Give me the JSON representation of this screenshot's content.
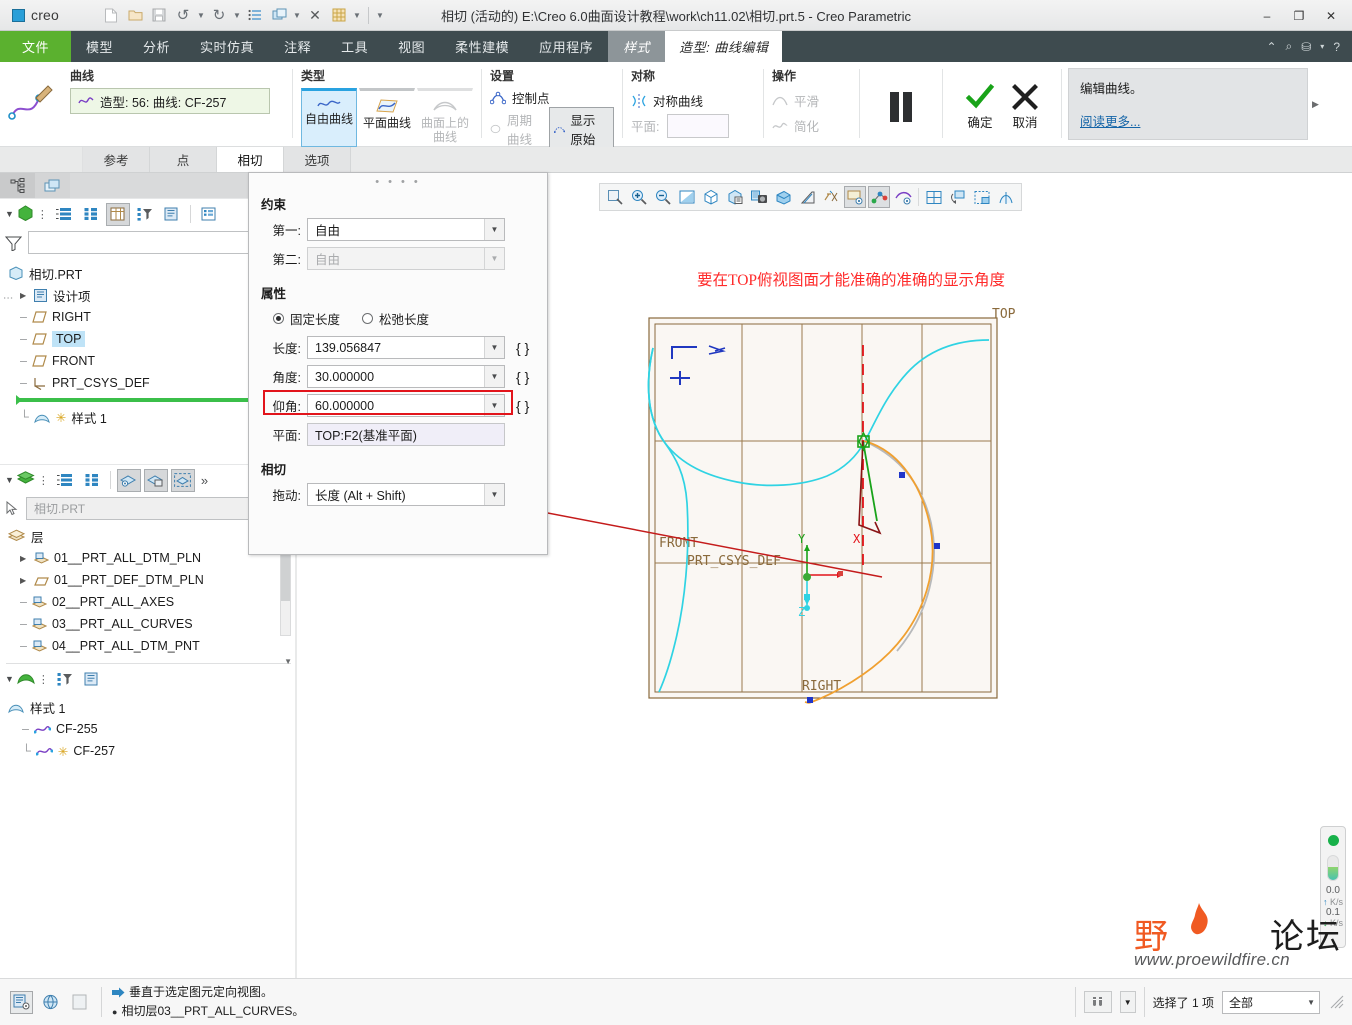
{
  "titlebar": {
    "brand": "creo",
    "title": "相切 (活动的) E:\\Creo 6.0曲面设计教程\\work\\ch11.02\\相切.prt.5 - Creo Parametric",
    "minimize": "–",
    "maximize": "❐",
    "close": "✕",
    "quick_access": [
      {
        "name": "new-file-icon",
        "glyph": "🗋"
      },
      {
        "name": "open-file-icon",
        "glyph": "🗁"
      },
      {
        "name": "save-icon",
        "glyph": "🖫"
      },
      {
        "name": "undo-icon",
        "glyph": "↰"
      },
      {
        "name": "redo-icon",
        "glyph": "↱"
      },
      {
        "name": "regenerate-icon",
        "glyph": "⣿"
      },
      {
        "name": "window-icon",
        "glyph": "❏"
      },
      {
        "name": "close-window-icon",
        "glyph": "⨯"
      },
      {
        "name": "grid-icon",
        "glyph": "▤"
      },
      {
        "name": "customize-icon",
        "glyph": "▾"
      }
    ]
  },
  "ribbon_tabs": {
    "file": "文件",
    "items": [
      "模型",
      "分析",
      "实时仿真",
      "注释",
      "工具",
      "视图",
      "柔性建模",
      "应用程序"
    ],
    "active_grey": "样式",
    "active_white": "造型: 曲线编辑",
    "right_icons": [
      "⌃",
      "⌕",
      "⛁",
      "▾",
      "?"
    ]
  },
  "ribbon": {
    "curve_group": {
      "title": "曲线",
      "value": "造型: 56: 曲线: CF-257"
    },
    "type_group": {
      "title": "类型",
      "buttons": [
        {
          "label": "自由曲线",
          "state": "selected"
        },
        {
          "label": "平面曲线",
          "state": "normal"
        },
        {
          "label": "曲面上的\n曲线",
          "state": "disabled"
        }
      ]
    },
    "settings_group": {
      "title": "设置",
      "control_points": "控制点",
      "periodic_curve": "周期曲线",
      "show_original": "显示原始"
    },
    "symmetry_group": {
      "title": "对称",
      "symmetric_curve": "对称曲线",
      "plane_label": "平面:",
      "plane_value": ""
    },
    "operations_group": {
      "title": "操作",
      "smooth": "平滑",
      "simplify": "简化"
    },
    "confirm": {
      "ok": "确定",
      "cancel": "取消"
    },
    "help": {
      "text": "编辑曲线。",
      "link": "阅读更多..."
    }
  },
  "subtabs": {
    "items": [
      "参考",
      "点",
      "相切",
      "选项"
    ],
    "selected": "相切"
  },
  "navigator": {
    "tree_panel": {
      "root": "相切.PRT",
      "filter_placeholder": "",
      "nodes": [
        {
          "label": "设计项",
          "icon": "design-items-icon",
          "expandable": true
        },
        {
          "label": "RIGHT",
          "icon": "datum-plane-icon"
        },
        {
          "label": "TOP",
          "icon": "datum-plane-icon",
          "highlighted": true
        },
        {
          "label": "FRONT",
          "icon": "datum-plane-icon"
        },
        {
          "label": "PRT_CSYS_DEF",
          "icon": "csys-icon"
        },
        {
          "label": "样式 1",
          "icon": "style-icon",
          "modified": true
        }
      ]
    },
    "layer_panel": {
      "filter_value": "相切.PRT",
      "root": "层",
      "layers": [
        {
          "label": "01__PRT_ALL_DTM_PLN",
          "expandable": true
        },
        {
          "label": "01__PRT_DEF_DTM_PLN",
          "expandable": true
        },
        {
          "label": "02__PRT_ALL_AXES"
        },
        {
          "label": "03__PRT_ALL_CURVES"
        },
        {
          "label": "04__PRT_ALL_DTM_PNT"
        }
      ]
    },
    "style_panel": {
      "root": "样式 1",
      "curves": [
        "CF-255",
        "CF-257"
      ],
      "modified_curve": "CF-257"
    }
  },
  "dialog": {
    "constraint_section": "约束",
    "first_label": "第一:",
    "first_value": "自由",
    "second_label": "第二:",
    "second_value": "自由",
    "properties_section": "属性",
    "fixed_length": "固定长度",
    "slack_length": "松弛长度",
    "length_label": "长度:",
    "length_value": "139.056847",
    "angle_label": "角度:",
    "angle_value": "30.000000",
    "elevation_label": "仰角:",
    "elevation_value": "60.000000",
    "plane_label": "平面:",
    "plane_value": "TOP:F2(基准平面)",
    "tangent_section": "相切",
    "drag_label": "拖动:",
    "drag_value": "长度 (Alt + Shift)",
    "braces": "{ }"
  },
  "graphics": {
    "toolbar_icons": [
      "refit-icon",
      "zoom-in-icon",
      "zoom-out-icon",
      "repaint-icon",
      "view-cube-icon",
      "saved-views-icon",
      "screenshot-icon",
      "display-style-icon",
      "perspective-icon",
      "datum-display-icon",
      "annotation-display-icon",
      "point-display-icon",
      "spin-center-icon",
      "plane-display-icon",
      "csys-display-icon",
      "section-icon",
      "layer-icon"
    ],
    "annotation": "要在TOP俯视图面才能准确的准确的显示角度",
    "view_labels": {
      "top": "TOP",
      "front": "FRONT",
      "right": "RIGHT",
      "csys": "PRT_CSYS_DEF",
      "axis_x": "X",
      "axis_y": "Y",
      "axis_z": "Z"
    }
  },
  "net_widget": {
    "up_value": "0.0",
    "up_unit": "K/s",
    "down_value": "0.1",
    "down_unit": "K/s"
  },
  "watermark": {
    "cn1": "野",
    "cn2": "火",
    "cn3": "论坛",
    "url": "www.proewildfire.cn"
  },
  "statusbar": {
    "message_1": "垂直于选定图元定向视图。",
    "message_2": "相切层03__PRT_ALL_CURVES。",
    "selection": "选择了 1 项",
    "filter": "全部"
  }
}
